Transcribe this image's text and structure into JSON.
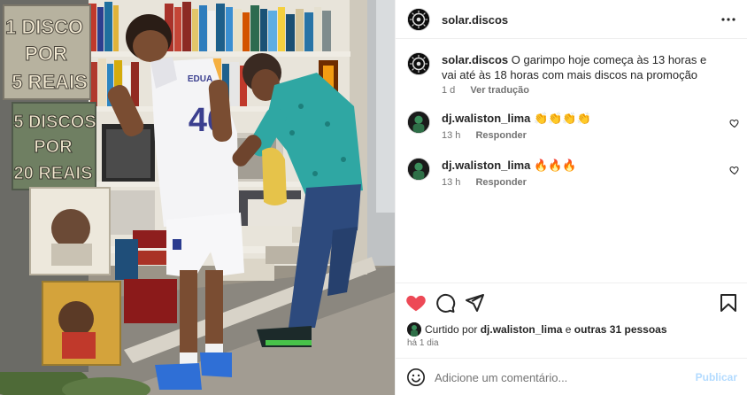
{
  "photo": {
    "alt": "Photo",
    "sign_top": [
      "1 DISCO",
      "POR",
      "5 REAIS"
    ],
    "sign_bottom": [
      "5 DISCOS",
      "POR",
      "20 REAIS"
    ],
    "jersey_number": "46",
    "jersey_name": "EDUA"
  },
  "header": {
    "username": "solar.discos",
    "more_icon": "more-horizontal-icon"
  },
  "caption": {
    "username": "solar.discos",
    "text": "O garimpo hoje começa às 13 horas e vai até às 18 horas com mais discos na promoção",
    "age": "1 d",
    "translate": "Ver tradução"
  },
  "comments": [
    {
      "username": "dj.waliston_lima",
      "text": "👏👏👏👏",
      "age": "13 h",
      "reply": "Responder"
    },
    {
      "username": "dj.waliston_lima",
      "text": "🔥🔥🔥",
      "age": "13 h",
      "reply": "Responder"
    }
  ],
  "actions": {
    "like_icon": "heart-filled-icon",
    "comment_icon": "comment-icon",
    "share_icon": "send-icon",
    "save_icon": "bookmark-icon",
    "liked_prefix": "Curtido por",
    "liked_user": "dj.waliston_lima",
    "liked_and": "e",
    "liked_others": "outras 31 pessoas",
    "post_age": "há 1 dia"
  },
  "add_comment": {
    "placeholder": "Adicione um comentário...",
    "publish": "Publicar",
    "emoji_icon": "emoji-icon"
  },
  "colors": {
    "like_red": "#ed4956",
    "muted": "#737373",
    "publish_disabled": "#b3dbff"
  }
}
